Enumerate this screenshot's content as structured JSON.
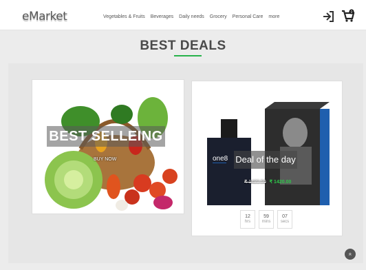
{
  "header": {
    "logo": "eMarket",
    "nav": [
      "Vegetables & Fruits",
      "Beverages",
      "Daily needs",
      "Grocery",
      "Personal Care",
      "more"
    ],
    "icons": {
      "login": "login-icon",
      "cart": "cart-icon"
    },
    "cart_count": "0"
  },
  "section": {
    "title": "BEST DEALS",
    "underline_color": "#27b24a"
  },
  "card_best": {
    "banner": "BEST SELLEING",
    "button": "BUY NOW"
  },
  "card_deal": {
    "banner": "Deal of the day",
    "brand": "one8",
    "old_price": "₹ 1489.50",
    "new_price": "₹ 1420.00",
    "countdown": [
      {
        "value": "12",
        "unit": "hrs"
      },
      {
        "value": "59",
        "unit": "mins"
      },
      {
        "value": "07",
        "unit": "secs"
      }
    ]
  },
  "scroll_top": {
    "icon": "chevron-double-up-icon",
    "glyph": "»"
  },
  "colors": {
    "accent": "#27b24a",
    "price_new": "#2ec84a"
  }
}
